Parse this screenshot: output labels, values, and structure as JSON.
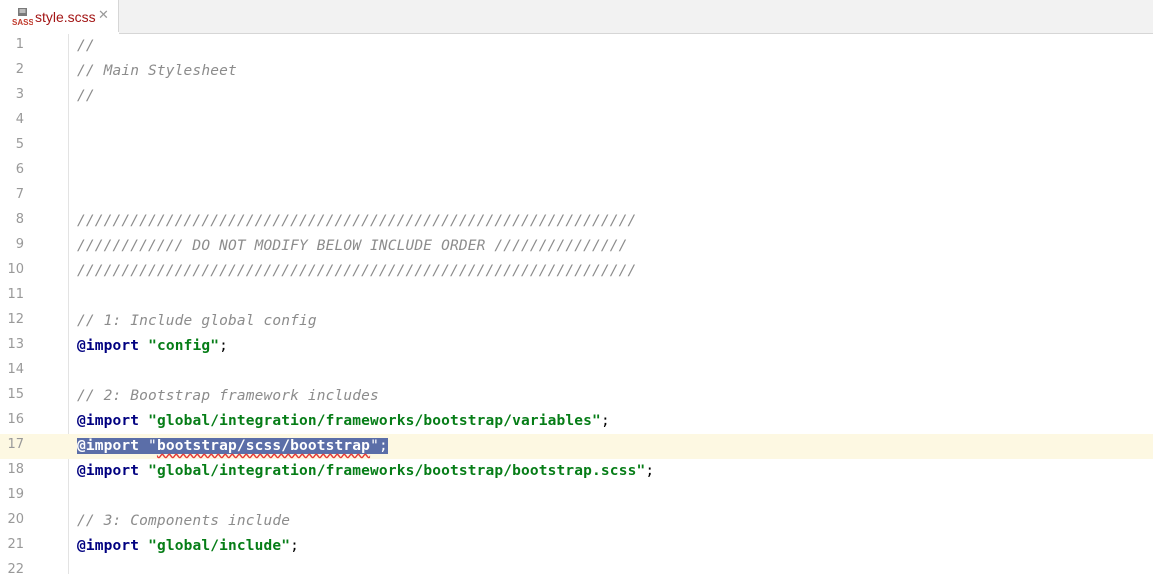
{
  "tab": {
    "icon_text": "SASS",
    "filename": "style.scss",
    "close_glyph": "✕"
  },
  "editor": {
    "current_line": 17,
    "lines": [
      {
        "n": "1",
        "parts": [
          {
            "t": "cmt",
            "v": "//"
          }
        ]
      },
      {
        "n": "2",
        "parts": [
          {
            "t": "cmt",
            "v": "// Main Stylesheet"
          }
        ]
      },
      {
        "n": "3",
        "parts": [
          {
            "t": "cmt",
            "v": "//"
          }
        ]
      },
      {
        "n": "4",
        "parts": []
      },
      {
        "n": "5",
        "parts": []
      },
      {
        "n": "6",
        "parts": []
      },
      {
        "n": "7",
        "parts": []
      },
      {
        "n": "8",
        "parts": [
          {
            "t": "cmt",
            "v": "///////////////////////////////////////////////////////////////"
          }
        ]
      },
      {
        "n": "9",
        "parts": [
          {
            "t": "cmt",
            "v": "//////////// DO NOT MODIFY BELOW INCLUDE ORDER ///////////////"
          }
        ]
      },
      {
        "n": "10",
        "parts": [
          {
            "t": "cmt",
            "v": "///////////////////////////////////////////////////////////////"
          }
        ]
      },
      {
        "n": "11",
        "parts": []
      },
      {
        "n": "12",
        "parts": [
          {
            "t": "cmt",
            "v": "// 1: Include global config"
          }
        ]
      },
      {
        "n": "13",
        "parts": [
          {
            "t": "kw",
            "v": "@import"
          },
          {
            "t": "punct",
            "v": " "
          },
          {
            "t": "str",
            "v": "\"config\""
          },
          {
            "t": "punct",
            "v": ";"
          }
        ]
      },
      {
        "n": "14",
        "parts": []
      },
      {
        "n": "15",
        "parts": [
          {
            "t": "cmt",
            "v": "// 2: Bootstrap framework includes"
          }
        ]
      },
      {
        "n": "16",
        "parts": [
          {
            "t": "kw",
            "v": "@import"
          },
          {
            "t": "punct",
            "v": " "
          },
          {
            "t": "str",
            "v": "\"global/integration/frameworks/bootstrap/variables\""
          },
          {
            "t": "punct",
            "v": ";"
          }
        ]
      },
      {
        "n": "17",
        "selected": true,
        "parts": [
          {
            "t": "kw",
            "v": "@import"
          },
          {
            "t": "punct",
            "v": " \""
          },
          {
            "t": "str squiggle",
            "v": "bootstrap/scss/bootstrap"
          },
          {
            "t": "punct",
            "v": "\";"
          }
        ]
      },
      {
        "n": "18",
        "parts": [
          {
            "t": "kw",
            "v": "@import"
          },
          {
            "t": "punct",
            "v": " "
          },
          {
            "t": "str",
            "v": "\"global/integration/frameworks/bootstrap/bootstrap.scss\""
          },
          {
            "t": "punct",
            "v": ";"
          }
        ]
      },
      {
        "n": "19",
        "parts": []
      },
      {
        "n": "20",
        "parts": [
          {
            "t": "cmt",
            "v": "// 3: Components include"
          }
        ]
      },
      {
        "n": "21",
        "parts": [
          {
            "t": "kw",
            "v": "@import"
          },
          {
            "t": "punct",
            "v": " "
          },
          {
            "t": "str",
            "v": "\"global/include\""
          },
          {
            "t": "punct",
            "v": ";"
          }
        ]
      },
      {
        "n": "22",
        "parts": []
      }
    ]
  }
}
